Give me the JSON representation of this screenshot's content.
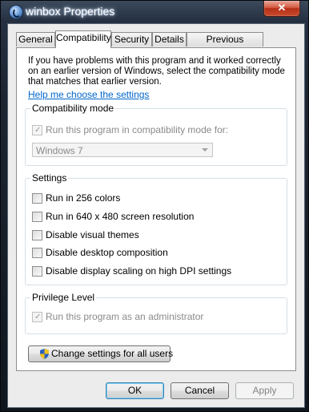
{
  "window": {
    "title": "winbox Properties",
    "close_glyph": "✕"
  },
  "tabs": [
    "General",
    "Compatibility",
    "Security",
    "Details",
    "Previous Versions"
  ],
  "active_tab": "Compatibility",
  "intro_text": "If you have problems with this program and it worked correctly on an earlier version of Windows, select the compatibility mode that matches that earlier version.",
  "help_link": "Help me choose the settings",
  "compatibility_mode": {
    "title": "Compatibility mode",
    "checkbox_label": "Run this program in compatibility mode for:",
    "checked": true,
    "enabled": false,
    "dropdown_value": "Windows 7"
  },
  "settings": {
    "title": "Settings",
    "options": [
      {
        "label": "Run in 256 colors",
        "checked": false
      },
      {
        "label": "Run in 640 x 480 screen resolution",
        "checked": false
      },
      {
        "label": "Disable visual themes",
        "checked": false
      },
      {
        "label": "Disable desktop composition",
        "checked": false
      },
      {
        "label": "Disable display scaling on high DPI settings",
        "checked": false
      }
    ]
  },
  "privilege": {
    "title": "Privilege Level",
    "checkbox_label": "Run this program as an administrator",
    "checked": true,
    "enabled": false
  },
  "change_all_users_button": "Change settings for all users",
  "buttons": {
    "ok": "OK",
    "cancel": "Cancel",
    "apply": "Apply"
  },
  "icons": {
    "app": "winbox-app-icon",
    "uac": "uac-shield-icon",
    "check": "✓"
  },
  "colors": {
    "link": "#0066cc",
    "title_glow": "#cfe2ff",
    "close_red": "#c84a2b"
  }
}
